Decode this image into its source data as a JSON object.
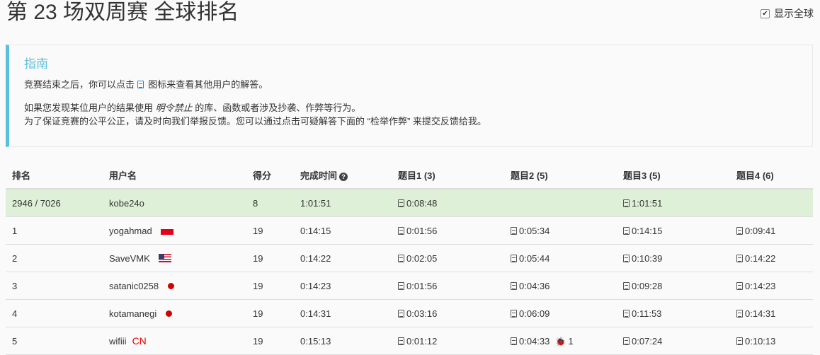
{
  "page": {
    "title": "第 23 场双周赛 全球排名",
    "show_all_label": "显示全球",
    "show_all_checked": "✔"
  },
  "guide": {
    "title": "指南",
    "line1_before": "竞赛结束之后，你可以点击",
    "line1_after": "图标来查看其他用户的解答。",
    "line2_before": "如果您发现某位用户的结果使用",
    "line2_forbidden": "明令禁止",
    "line2_after": "的库、函数或者涉及抄袭、作弊等行为。",
    "line3": "为了保证竞赛的公平公正，请及时向我们举报反馈。您可以通过点击可疑解答下面的 “检举作弊” 来提交反馈给我。"
  },
  "table": {
    "headers": {
      "rank": "排名",
      "user": "用户名",
      "score": "得分",
      "finish_time": "完成时间",
      "q1": "题目1 (3)",
      "q2": "题目2 (5)",
      "q3": "题目3 (5)",
      "q4": "题目4 (6)"
    },
    "rows": [
      {
        "rank": "2946 / 7026",
        "user": "kobe24o",
        "flag": "",
        "score": "8",
        "time": "1:01:51",
        "q1": "0:08:48",
        "q2": "",
        "q3": "1:01:51",
        "q4": "",
        "bugs": ""
      },
      {
        "rank": "1",
        "user": "yogahmad",
        "flag": "id",
        "score": "19",
        "time": "0:14:15",
        "q1": "0:01:56",
        "q2": "0:05:34",
        "q3": "0:14:15",
        "q4": "0:09:41",
        "bugs": ""
      },
      {
        "rank": "2",
        "user": "SaveVMK",
        "flag": "us",
        "score": "19",
        "time": "0:14:22",
        "q1": "0:02:05",
        "q2": "0:05:44",
        "q3": "0:10:39",
        "q4": "0:14:22",
        "bugs": ""
      },
      {
        "rank": "3",
        "user": "satanic0258",
        "flag": "jp",
        "score": "19",
        "time": "0:14:23",
        "q1": "0:01:56",
        "q2": "0:04:36",
        "q3": "0:09:28",
        "q4": "0:14:23",
        "bugs": ""
      },
      {
        "rank": "4",
        "user": "kotamanegi",
        "flag": "jp",
        "score": "19",
        "time": "0:14:31",
        "q1": "0:03:16",
        "q2": "0:06:09",
        "q3": "0:11:53",
        "q4": "0:14:31",
        "bugs": ""
      },
      {
        "rank": "5",
        "user": "wifiii",
        "flag": "CN",
        "score": "19",
        "time": "0:15:13",
        "q1": "0:01:12",
        "q2": "0:04:33",
        "q3": "0:07:24",
        "q4": "0:10:13",
        "bugs": "1"
      }
    ]
  },
  "colors": {
    "accent": "#5bc0de",
    "highlight_row": "#dff0d8",
    "bug": "#cc0000"
  },
  "icons": {
    "solution": "file-code-icon",
    "help": "question-circle-icon",
    "bug": "bug-icon"
  }
}
